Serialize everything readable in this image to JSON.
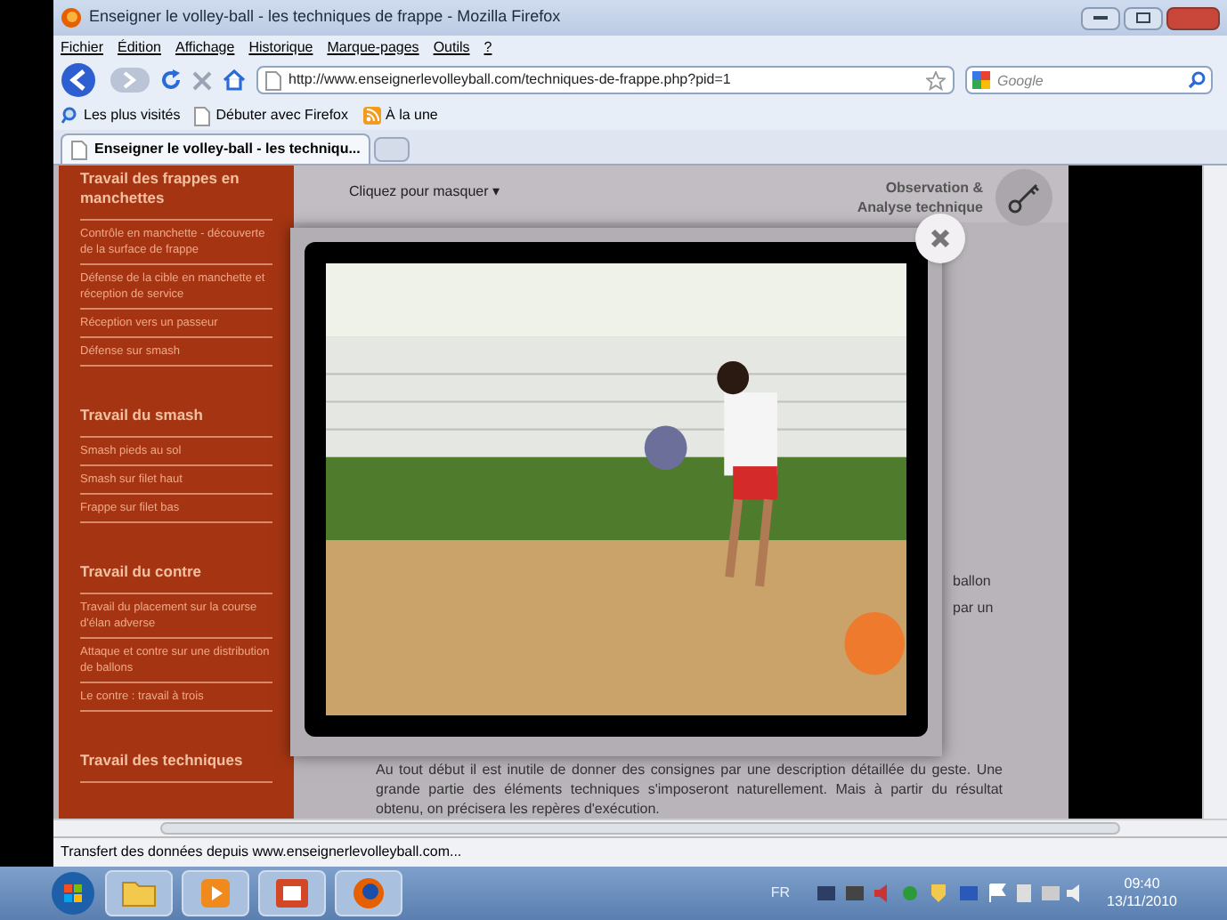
{
  "window": {
    "title": "Enseigner le volley-ball - les techniques de frappe - Mozilla Firefox"
  },
  "menu": [
    "Fichier",
    "Édition",
    "Affichage",
    "Historique",
    "Marque-pages",
    "Outils",
    "?"
  ],
  "navigation": {
    "url": "http://www.enseignerlevolleyball.com/techniques-de-frappe.php?pid=1",
    "search_placeholder": "Google"
  },
  "bookmarks": [
    {
      "label": "Les plus visités",
      "kind": "search"
    },
    {
      "label": "Débuter avec Firefox",
      "kind": "page"
    },
    {
      "label": "À la une",
      "kind": "feed"
    }
  ],
  "tabs": [
    {
      "label": "Enseigner le volley-ball - les techniqu...",
      "selected": true
    }
  ],
  "sidebar": {
    "sections": [
      {
        "title": "Travail des frappes en manchettes",
        "items": [
          "Contrôle en manchette - découverte de la surface de frappe",
          "Défense de la cible en manchette et réception de service",
          "Réception vers un passeur",
          "Défense sur smash"
        ]
      },
      {
        "title": "Travail du smash",
        "items": [
          "Smash pieds au sol",
          "Smash sur filet haut",
          "Frappe sur filet bas"
        ]
      },
      {
        "title": "Travail du contre",
        "items": [
          "Travail du placement sur la course d'élan adverse",
          "Attaque et contre sur une distribution de ballons",
          "Le contre : travail à trois"
        ]
      },
      {
        "title": "Travail des techniques"
      }
    ]
  },
  "page": {
    "toggle": "Cliquez pour masquer ▾",
    "section_title": [
      "Observation &",
      "Analyse technique"
    ],
    "side_text": [
      "ballon",
      "par un"
    ],
    "paragraph": "Au tout début il est inutile de donner des consignes par une description détaillée du geste. Une grande partie des éléments techniques s'imposeront naturellement. Mais à partir du résultat obtenu, on précisera les repères d'exécution."
  },
  "status_bar": "Transfert des données depuis www.enseignerlevolleyball.com...",
  "taskbar": {
    "apps": [
      {
        "kind": "explorer"
      },
      {
        "kind": "media"
      },
      {
        "kind": "presentation"
      },
      {
        "kind": "browser"
      }
    ],
    "language": "FR",
    "time": "09:40",
    "date": "13/11/2010"
  }
}
